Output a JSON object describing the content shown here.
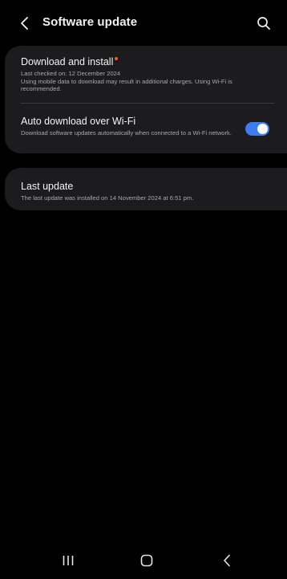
{
  "header": {
    "title": "Software update",
    "back_icon": "chevron-left-icon",
    "search_icon": "search-icon"
  },
  "download_install": {
    "title": "Download and install",
    "last_checked": "Last checked on: 12 December 2024",
    "note": "Using mobile data to download may result in additional charges. Using Wi-Fi is recommended.",
    "badge_color": "#ff5a1f"
  },
  "auto_download": {
    "title": "Auto download over Wi-Fi",
    "description": "Download software updates automatically when connected to a Wi-Fi network.",
    "enabled": true,
    "toggle_color": "#3e7cf2"
  },
  "last_update": {
    "title": "Last update",
    "description": "The last update was installed on 14 November 2024 at 6:51 pm."
  },
  "navbar": {
    "recents_icon": "recents-icon",
    "home_icon": "home-icon",
    "back_icon": "back-icon"
  }
}
